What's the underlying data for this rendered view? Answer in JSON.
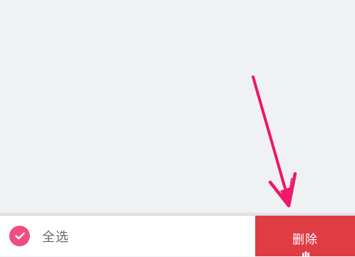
{
  "bottom_bar": {
    "select_all": {
      "label": "全选",
      "icon": "check-circle-icon",
      "checked": true
    },
    "delete_button": {
      "label": "删除"
    }
  },
  "colors": {
    "accent": "#ee4f7f",
    "delete_background": "#e03c44",
    "annotation_arrow": "#f0186a",
    "content_background": "#f0f1f3"
  },
  "annotation": {
    "icon": "pointer-arrow-icon"
  }
}
